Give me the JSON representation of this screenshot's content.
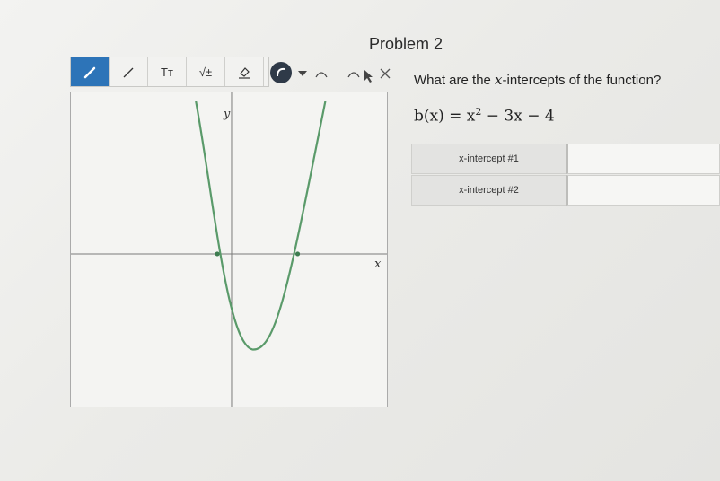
{
  "page": {
    "title": "Problem 2"
  },
  "toolbar": {
    "tools": [
      {
        "icon": "pencil-icon",
        "active": true
      },
      {
        "icon": "line-icon",
        "active": false
      },
      {
        "icon": "text-icon",
        "label": "Tт",
        "active": false
      },
      {
        "icon": "math-icon",
        "label": "√±",
        "active": false
      },
      {
        "icon": "eraser-icon",
        "active": false
      }
    ],
    "extra": [
      "curve-tool-icon",
      "dropdown-arrow-icon",
      "undo-icon",
      "redo-icon",
      "cursor-icon",
      "close-icon"
    ]
  },
  "graph": {
    "y_label": "y",
    "x_label": "x"
  },
  "question": {
    "prefix": "What are the ",
    "var": "x",
    "suffix": "-intercepts of the function?"
  },
  "formula": {
    "lhs": "b(x) = x",
    "exp": "2",
    "rhs": " − 3x − 4"
  },
  "answer_table": {
    "rows": [
      {
        "label": "x-intercept #1",
        "value": ""
      },
      {
        "label": "x-intercept #2",
        "value": ""
      }
    ]
  },
  "colors": {
    "accent": "#2d74b8",
    "curve": "#5a9a6a"
  }
}
